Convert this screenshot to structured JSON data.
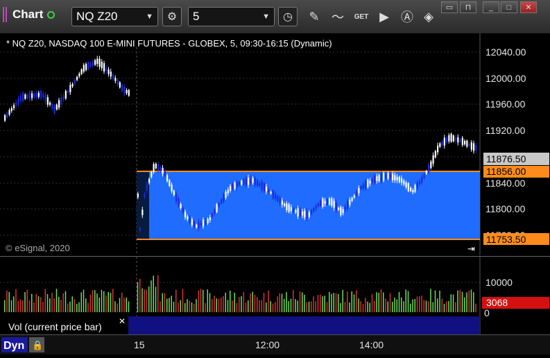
{
  "app": {
    "title": "Chart"
  },
  "toolbar": {
    "symbol": "NQ Z20",
    "interval": "5",
    "icons": [
      "settings-gear-icon",
      "clock-icon",
      "pencil-icon",
      "study-icon",
      "get-icon",
      "play-icon",
      "alert-icon",
      "fill-bucket-icon"
    ],
    "get_label": "GET"
  },
  "chart": {
    "header": "* NQ Z20, NASDAQ 100 E-MINI FUTURES - GLOBEX, 5, 09:30-16:15 (Dynamic)",
    "copyright": "© eSignal, 2020",
    "price_ticks": [
      "12040.00",
      "12000.00",
      "11960.00",
      "11920.00",
      "11840.00",
      "11800.00",
      "11760.00"
    ],
    "price_labels": {
      "last": "11876.50",
      "upper": "11856.00",
      "lower": "11753.50"
    },
    "vol_tick": "10000",
    "vol_zero": "0",
    "vol_last": "3068",
    "vol_legend": "Vol (current price bar)",
    "time_ticks": [
      "15",
      "12:00",
      "14:00"
    ],
    "colors": {
      "box": "#1f6cff",
      "box_line": "#ff8c1a",
      "up": "#ffffff",
      "down": "#1d2ad8",
      "vol_up": "#6ede5a",
      "vol_down": "#d63434"
    }
  },
  "bottom": {
    "mode": "Dyn"
  }
}
